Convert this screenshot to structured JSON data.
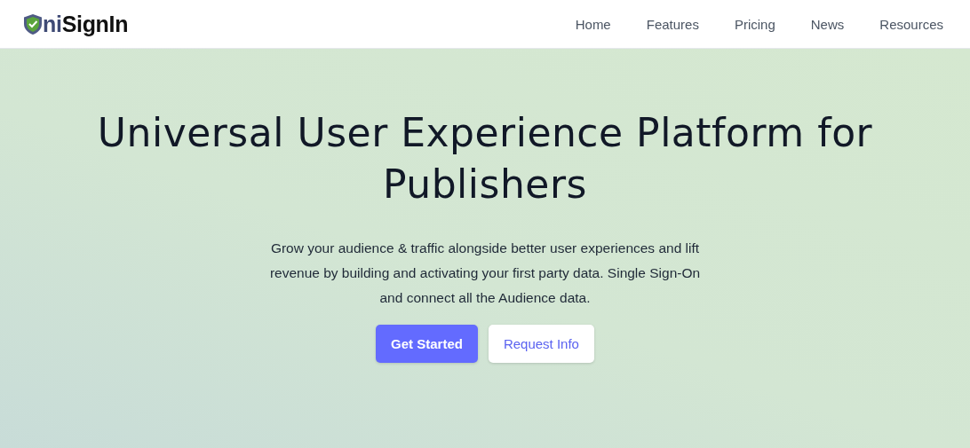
{
  "header": {
    "logo": {
      "accent_text": "ni",
      "text": "SignIn"
    },
    "nav": [
      {
        "label": "Home"
      },
      {
        "label": "Features"
      },
      {
        "label": "Pricing"
      },
      {
        "label": "News"
      },
      {
        "label": "Resources"
      }
    ]
  },
  "hero": {
    "title": "Universal User Experience Platform for Publishers",
    "description": "Grow your audience & traffic alongside better user experiences and lift revenue by building and activating your first party data. Single Sign-On and connect all the Audience data.",
    "buttons": [
      {
        "label": "Get Started",
        "kind": "primary"
      },
      {
        "label": "Request Info",
        "kind": "secondary"
      }
    ]
  }
}
